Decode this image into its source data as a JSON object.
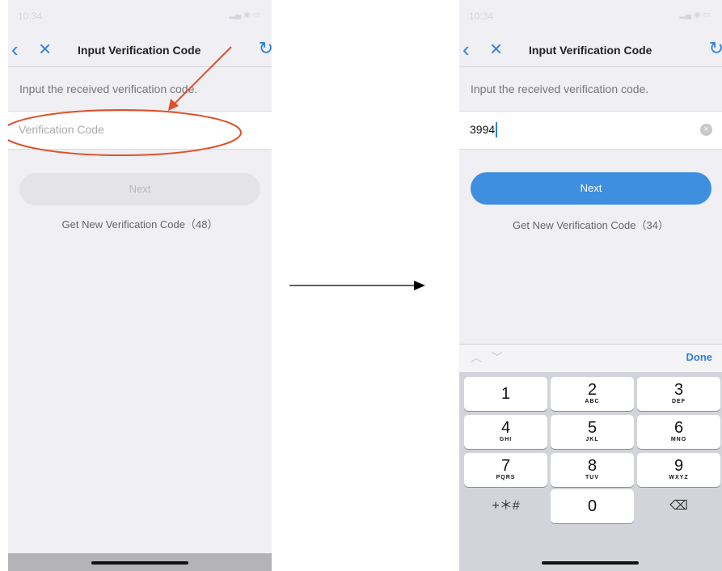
{
  "screens": [
    {
      "title": "Input Verification Code",
      "instruction": "Input the received verification code.",
      "input": {
        "value": "",
        "placeholder": "Verification Code"
      },
      "next_label": "Next",
      "next_enabled": false,
      "resend_label": "Get New Verification Code（48）"
    },
    {
      "title": "Input Verification Code",
      "instruction": "Input the received verification code.",
      "input": {
        "value": "3994",
        "placeholder": "Verification Code"
      },
      "next_label": "Next",
      "next_enabled": true,
      "resend_label": "Get New Verification Code（34）",
      "keyboard": {
        "done_label": "Done",
        "keys": [
          {
            "num": "1",
            "letters": ""
          },
          {
            "num": "2",
            "letters": "ABC"
          },
          {
            "num": "3",
            "letters": "DEF"
          },
          {
            "num": "4",
            "letters": "GHI"
          },
          {
            "num": "5",
            "letters": "JKL"
          },
          {
            "num": "6",
            "letters": "MNO"
          },
          {
            "num": "7",
            "letters": "PQRS"
          },
          {
            "num": "8",
            "letters": "TUV"
          },
          {
            "num": "9",
            "letters": "WXYZ"
          },
          {
            "num": "+＊#",
            "letters": ""
          },
          {
            "num": "0",
            "letters": ""
          }
        ]
      }
    }
  ],
  "icons": {
    "back": "chevron-left-icon",
    "close": "close-icon",
    "refresh": "refresh-icon",
    "clear": "clear-icon",
    "backspace": "backspace-icon"
  },
  "colors": {
    "accent": "#3e8fe0",
    "annotation": "#e0502a",
    "background": "#efeff4",
    "disabled_button": "#e3e3e8"
  }
}
